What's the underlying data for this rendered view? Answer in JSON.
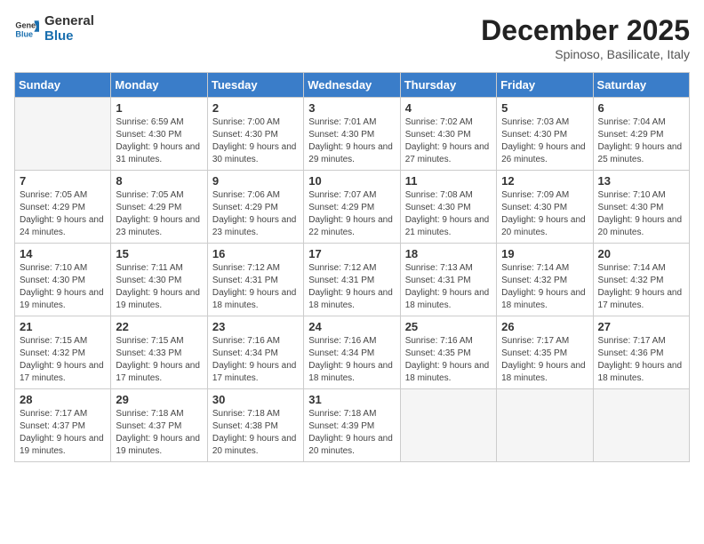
{
  "header": {
    "logo_general": "General",
    "logo_blue": "Blue",
    "month": "December 2025",
    "location": "Spinoso, Basilicate, Italy"
  },
  "days_of_week": [
    "Sunday",
    "Monday",
    "Tuesday",
    "Wednesday",
    "Thursday",
    "Friday",
    "Saturday"
  ],
  "weeks": [
    [
      {
        "day": "",
        "sunrise": "",
        "sunset": "",
        "daylight": ""
      },
      {
        "day": "1",
        "sunrise": "Sunrise: 6:59 AM",
        "sunset": "Sunset: 4:30 PM",
        "daylight": "Daylight: 9 hours and 31 minutes."
      },
      {
        "day": "2",
        "sunrise": "Sunrise: 7:00 AM",
        "sunset": "Sunset: 4:30 PM",
        "daylight": "Daylight: 9 hours and 30 minutes."
      },
      {
        "day": "3",
        "sunrise": "Sunrise: 7:01 AM",
        "sunset": "Sunset: 4:30 PM",
        "daylight": "Daylight: 9 hours and 29 minutes."
      },
      {
        "day": "4",
        "sunrise": "Sunrise: 7:02 AM",
        "sunset": "Sunset: 4:30 PM",
        "daylight": "Daylight: 9 hours and 27 minutes."
      },
      {
        "day": "5",
        "sunrise": "Sunrise: 7:03 AM",
        "sunset": "Sunset: 4:30 PM",
        "daylight": "Daylight: 9 hours and 26 minutes."
      },
      {
        "day": "6",
        "sunrise": "Sunrise: 7:04 AM",
        "sunset": "Sunset: 4:29 PM",
        "daylight": "Daylight: 9 hours and 25 minutes."
      }
    ],
    [
      {
        "day": "7",
        "sunrise": "Sunrise: 7:05 AM",
        "sunset": "Sunset: 4:29 PM",
        "daylight": "Daylight: 9 hours and 24 minutes."
      },
      {
        "day": "8",
        "sunrise": "Sunrise: 7:05 AM",
        "sunset": "Sunset: 4:29 PM",
        "daylight": "Daylight: 9 hours and 23 minutes."
      },
      {
        "day": "9",
        "sunrise": "Sunrise: 7:06 AM",
        "sunset": "Sunset: 4:29 PM",
        "daylight": "Daylight: 9 hours and 23 minutes."
      },
      {
        "day": "10",
        "sunrise": "Sunrise: 7:07 AM",
        "sunset": "Sunset: 4:29 PM",
        "daylight": "Daylight: 9 hours and 22 minutes."
      },
      {
        "day": "11",
        "sunrise": "Sunrise: 7:08 AM",
        "sunset": "Sunset: 4:30 PM",
        "daylight": "Daylight: 9 hours and 21 minutes."
      },
      {
        "day": "12",
        "sunrise": "Sunrise: 7:09 AM",
        "sunset": "Sunset: 4:30 PM",
        "daylight": "Daylight: 9 hours and 20 minutes."
      },
      {
        "day": "13",
        "sunrise": "Sunrise: 7:10 AM",
        "sunset": "Sunset: 4:30 PM",
        "daylight": "Daylight: 9 hours and 20 minutes."
      }
    ],
    [
      {
        "day": "14",
        "sunrise": "Sunrise: 7:10 AM",
        "sunset": "Sunset: 4:30 PM",
        "daylight": "Daylight: 9 hours and 19 minutes."
      },
      {
        "day": "15",
        "sunrise": "Sunrise: 7:11 AM",
        "sunset": "Sunset: 4:30 PM",
        "daylight": "Daylight: 9 hours and 19 minutes."
      },
      {
        "day": "16",
        "sunrise": "Sunrise: 7:12 AM",
        "sunset": "Sunset: 4:31 PM",
        "daylight": "Daylight: 9 hours and 18 minutes."
      },
      {
        "day": "17",
        "sunrise": "Sunrise: 7:12 AM",
        "sunset": "Sunset: 4:31 PM",
        "daylight": "Daylight: 9 hours and 18 minutes."
      },
      {
        "day": "18",
        "sunrise": "Sunrise: 7:13 AM",
        "sunset": "Sunset: 4:31 PM",
        "daylight": "Daylight: 9 hours and 18 minutes."
      },
      {
        "day": "19",
        "sunrise": "Sunrise: 7:14 AM",
        "sunset": "Sunset: 4:32 PM",
        "daylight": "Daylight: 9 hours and 18 minutes."
      },
      {
        "day": "20",
        "sunrise": "Sunrise: 7:14 AM",
        "sunset": "Sunset: 4:32 PM",
        "daylight": "Daylight: 9 hours and 17 minutes."
      }
    ],
    [
      {
        "day": "21",
        "sunrise": "Sunrise: 7:15 AM",
        "sunset": "Sunset: 4:32 PM",
        "daylight": "Daylight: 9 hours and 17 minutes."
      },
      {
        "day": "22",
        "sunrise": "Sunrise: 7:15 AM",
        "sunset": "Sunset: 4:33 PM",
        "daylight": "Daylight: 9 hours and 17 minutes."
      },
      {
        "day": "23",
        "sunrise": "Sunrise: 7:16 AM",
        "sunset": "Sunset: 4:34 PM",
        "daylight": "Daylight: 9 hours and 17 minutes."
      },
      {
        "day": "24",
        "sunrise": "Sunrise: 7:16 AM",
        "sunset": "Sunset: 4:34 PM",
        "daylight": "Daylight: 9 hours and 18 minutes."
      },
      {
        "day": "25",
        "sunrise": "Sunrise: 7:16 AM",
        "sunset": "Sunset: 4:35 PM",
        "daylight": "Daylight: 9 hours and 18 minutes."
      },
      {
        "day": "26",
        "sunrise": "Sunrise: 7:17 AM",
        "sunset": "Sunset: 4:35 PM",
        "daylight": "Daylight: 9 hours and 18 minutes."
      },
      {
        "day": "27",
        "sunrise": "Sunrise: 7:17 AM",
        "sunset": "Sunset: 4:36 PM",
        "daylight": "Daylight: 9 hours and 18 minutes."
      }
    ],
    [
      {
        "day": "28",
        "sunrise": "Sunrise: 7:17 AM",
        "sunset": "Sunset: 4:37 PM",
        "daylight": "Daylight: 9 hours and 19 minutes."
      },
      {
        "day": "29",
        "sunrise": "Sunrise: 7:18 AM",
        "sunset": "Sunset: 4:37 PM",
        "daylight": "Daylight: 9 hours and 19 minutes."
      },
      {
        "day": "30",
        "sunrise": "Sunrise: 7:18 AM",
        "sunset": "Sunset: 4:38 PM",
        "daylight": "Daylight: 9 hours and 20 minutes."
      },
      {
        "day": "31",
        "sunrise": "Sunrise: 7:18 AM",
        "sunset": "Sunset: 4:39 PM",
        "daylight": "Daylight: 9 hours and 20 minutes."
      },
      {
        "day": "",
        "sunrise": "",
        "sunset": "",
        "daylight": ""
      },
      {
        "day": "",
        "sunrise": "",
        "sunset": "",
        "daylight": ""
      },
      {
        "day": "",
        "sunrise": "",
        "sunset": "",
        "daylight": ""
      }
    ]
  ]
}
